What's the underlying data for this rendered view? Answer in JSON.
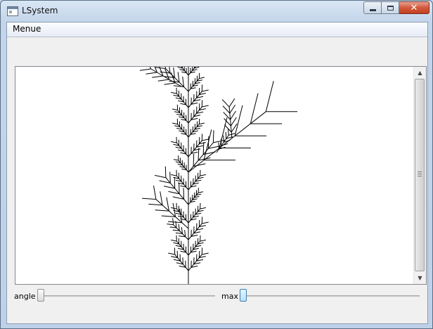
{
  "window": {
    "title": "LSystem",
    "icon": "app-window-icon"
  },
  "menu": {
    "items": [
      {
        "label": "Menue"
      }
    ]
  },
  "canvas": {
    "content": "L-system fractal plant",
    "stroke_color": "#000000",
    "background": "#ffffff"
  },
  "scrollbar": {
    "orientation": "vertical"
  },
  "controls": {
    "angle_label": "angle",
    "max_label": "max",
    "angle_value_fraction": 0.0,
    "max_value_fraction": 0.0
  },
  "colors": {
    "title_gradient": "#c8d9ed",
    "close_button": "#c4401f",
    "focus_handle": "#3c7fb1"
  }
}
